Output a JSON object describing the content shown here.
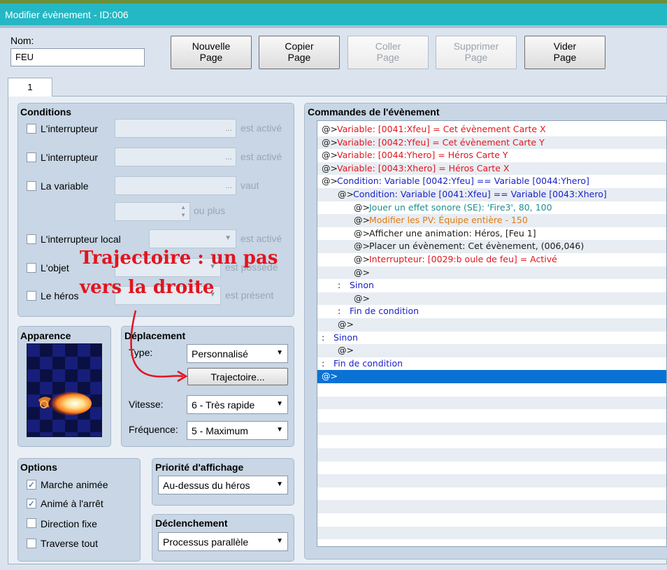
{
  "window": {
    "title": "Modifier évènement - ID:006"
  },
  "name_field": {
    "label": "Nom:",
    "value": "FEU"
  },
  "page_buttons": [
    {
      "label_line1": "Nouvelle",
      "label_line2": "Page",
      "enabled": true
    },
    {
      "label_line1": "Copier",
      "label_line2": "Page",
      "enabled": true
    },
    {
      "label_line1": "Coller",
      "label_line2": "Page",
      "enabled": false
    },
    {
      "label_line1": "Supprimer",
      "label_line2": "Page",
      "enabled": false
    },
    {
      "label_line1": "Vider",
      "label_line2": "Page",
      "enabled": true
    }
  ],
  "tabs": [
    {
      "label": "1"
    }
  ],
  "conditions": {
    "title": "Conditions",
    "rows": [
      {
        "label": "L'interrupteur",
        "suffix": "est activé",
        "checked": false
      },
      {
        "label": "L'interrupteur",
        "suffix": "est activé",
        "checked": false
      },
      {
        "label": "La variable",
        "suffix": "vaut",
        "checked": false
      },
      {
        "label": "",
        "suffix": "ou plus",
        "checked": false
      },
      {
        "label": "L'interrupteur local",
        "suffix": "est activé",
        "checked": false
      },
      {
        "label": "L'objet",
        "suffix": "est possédé",
        "checked": false
      },
      {
        "label": "Le héros",
        "suffix": "est présent",
        "checked": false
      }
    ],
    "dots": "..."
  },
  "appearance": {
    "title": "Apparence"
  },
  "movement": {
    "title": "Déplacement",
    "type_label": "Type:",
    "type_value": "Personnalisé",
    "route_button": "Trajectoire...",
    "speed_label": "Vitesse:",
    "speed_value": "6 - Très rapide",
    "freq_label": "Fréquence:",
    "freq_value": "5 - Maximum"
  },
  "options": {
    "title": "Options",
    "items": [
      {
        "label": "Marche animée",
        "checked": true
      },
      {
        "label": "Animé à l'arrêt",
        "checked": true
      },
      {
        "label": "Direction fixe",
        "checked": false
      },
      {
        "label": "Traverse tout",
        "checked": false
      }
    ]
  },
  "priority": {
    "title": "Priorité d'affichage",
    "value": "Au-dessus du héros"
  },
  "trigger": {
    "title": "Déclenchement",
    "value": "Processus parallèle"
  },
  "commands": {
    "title": "Commandes de l'évènement",
    "rows": [
      {
        "prefix": "@>",
        "text": "Variable: [0041:Xfeu] = Cet évènement Carte X",
        "color": "#e0161e",
        "indent": 0
      },
      {
        "prefix": "@>",
        "text": "Variable: [0042:Yfeu] = Cet évènement Carte Y",
        "color": "#e0161e",
        "indent": 0
      },
      {
        "prefix": "@>",
        "text": "Variable: [0044:Yhero] = Héros Carte Y",
        "color": "#e0161e",
        "indent": 0
      },
      {
        "prefix": "@>",
        "text": "Variable: [0043:Xhero] = Héros Carte X",
        "color": "#e0161e",
        "indent": 0
      },
      {
        "prefix": "@>",
        "text": "Condition: Variable [0042:Yfeu] == Variable [0044:Yhero]",
        "color": "#1a22c8",
        "indent": 0
      },
      {
        "prefix": "@>",
        "text": "Condition: Variable [0041:Xfeu] == Variable [0043:Xhero]",
        "color": "#1a22c8",
        "indent": 1
      },
      {
        "prefix": "@>",
        "text": "Jouer un effet sonore (SE): 'Fire3', 80, 100",
        "color": "#1c8f8f",
        "indent": 2
      },
      {
        "prefix": "@>",
        "text": "Modifier les PV: Équipe entière - 150",
        "color": "#e07a10",
        "indent": 2
      },
      {
        "prefix": "@>",
        "text": "Afficher une animation: Héros, [Feu 1]",
        "color": "#1a1a1a",
        "indent": 2
      },
      {
        "prefix": "@>",
        "text": "Placer un évènement: Cet évènement, (006,046)",
        "color": "#1a1a1a",
        "indent": 2
      },
      {
        "prefix": "@>",
        "text": "Interrupteur: [0029:b oule de feu] = Activé",
        "color": "#e0161e",
        "indent": 2
      },
      {
        "prefix": "@>",
        "text": "",
        "color": "#1a1a1a",
        "indent": 2
      },
      {
        "prefix": ":",
        "text": "Sinon",
        "color": "#1a22c8",
        "indent": 1
      },
      {
        "prefix": "@>",
        "text": "",
        "color": "#1a1a1a",
        "indent": 2
      },
      {
        "prefix": ":",
        "text": "Fin de condition",
        "color": "#1a22c8",
        "indent": 1
      },
      {
        "prefix": "@>",
        "text": "",
        "color": "#1a1a1a",
        "indent": 1
      },
      {
        "prefix": ":",
        "text": "Sinon",
        "color": "#1a22c8",
        "indent": 0
      },
      {
        "prefix": "@>",
        "text": "",
        "color": "#1a1a1a",
        "indent": 1
      },
      {
        "prefix": ":",
        "text": "Fin de condition",
        "color": "#1a22c8",
        "indent": 0
      },
      {
        "prefix": "@>",
        "text": "",
        "color": "#ffffff",
        "indent": 0,
        "selected": true
      }
    ]
  },
  "annotation": {
    "line1": "Trajectoire : un pas",
    "line2": "vers la droite",
    "color": "#e2141e"
  }
}
